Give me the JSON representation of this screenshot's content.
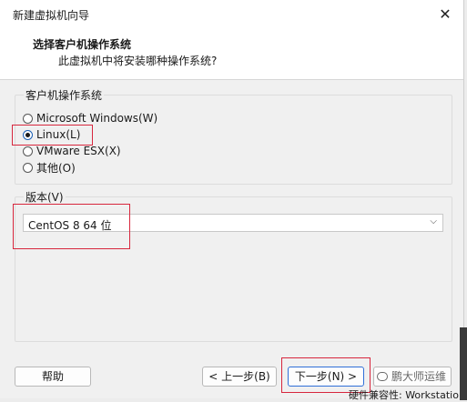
{
  "window": {
    "title": "新建虚拟机向导"
  },
  "header": {
    "title": "选择客户机操作系统",
    "subtitle": "此虚拟机中将安装哪种操作系统?"
  },
  "os_group": {
    "label": "客户机操作系统",
    "options": [
      {
        "label": "Microsoft Windows(W)",
        "checked": false
      },
      {
        "label": "Linux(L)",
        "checked": true
      },
      {
        "label": "VMware ESX(X)",
        "checked": false
      },
      {
        "label": "其他(O)",
        "checked": false
      }
    ]
  },
  "version_group": {
    "label": "版本(V)",
    "selected": "CentOS 8 64 位"
  },
  "buttons": {
    "help": "帮助",
    "back": "< 上一步(B)",
    "next": "下一步(N) >"
  },
  "watermark": {
    "text": "鹏大师运维"
  },
  "background_text": "硬件兼容性: Workstatio",
  "colors": {
    "highlight_box": "#d7263d",
    "primary_border": "#2f6fd8"
  },
  "icons": {
    "close": "close-icon",
    "dropdown": "chevron-down-icon",
    "watermark": "wechat-icon"
  }
}
